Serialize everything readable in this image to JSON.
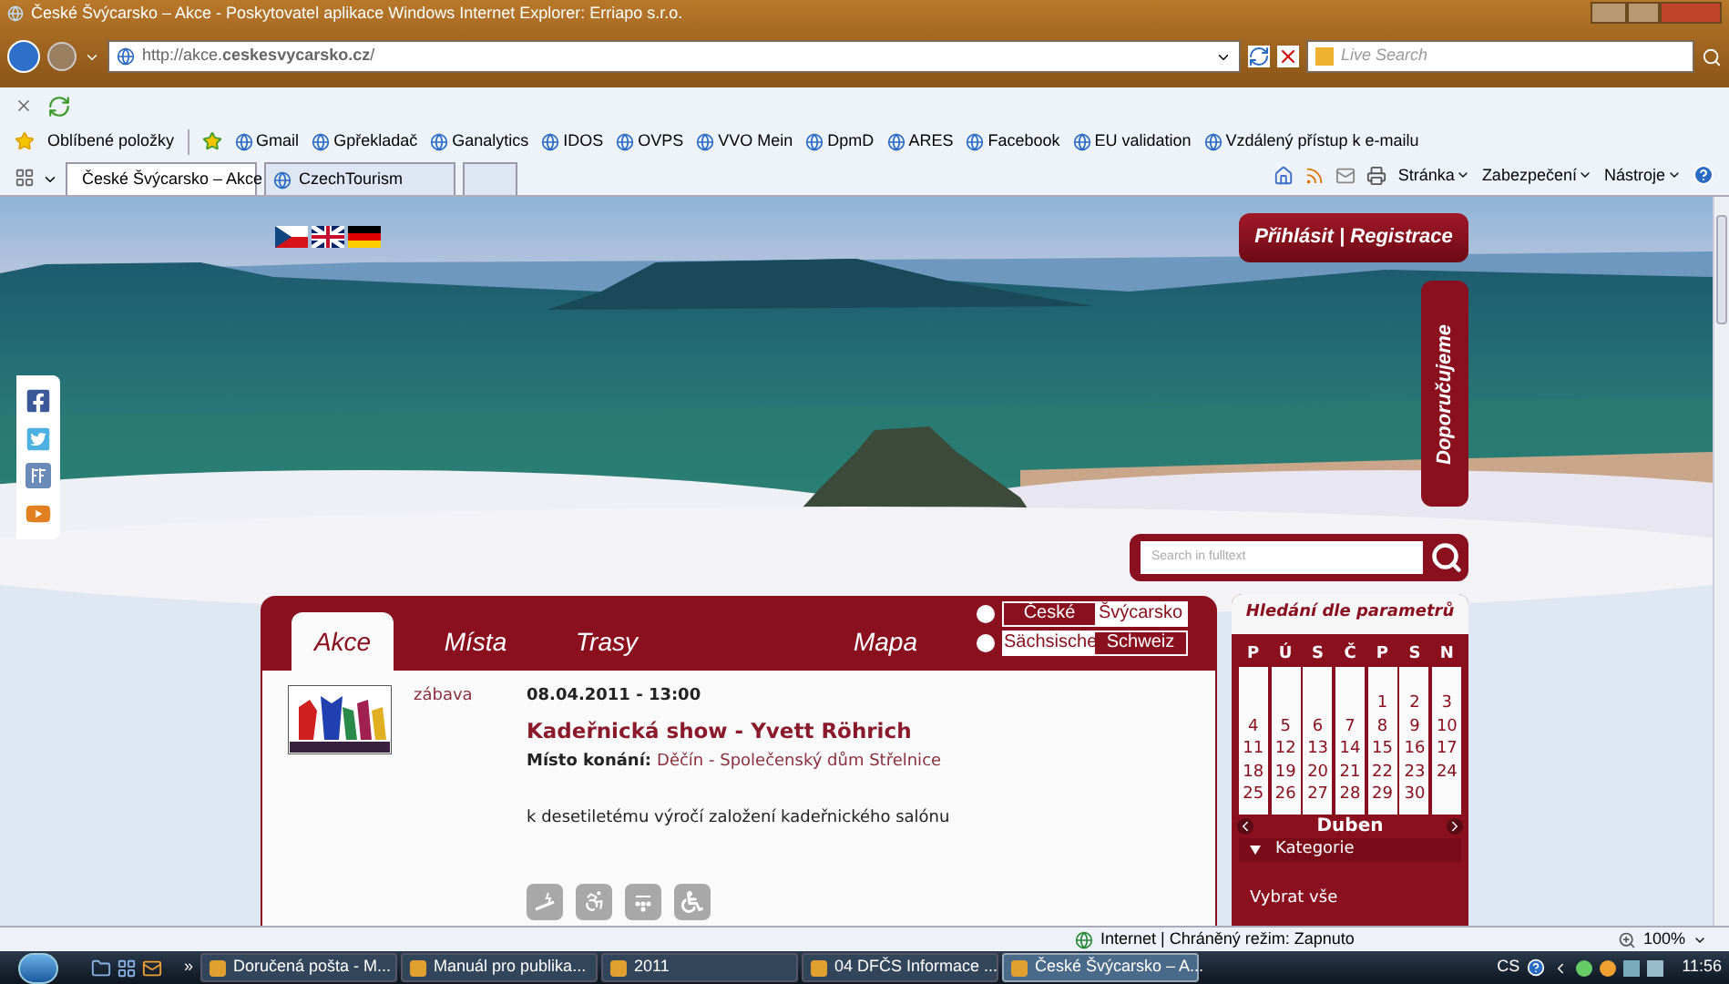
{
  "window": {
    "title": "České Švýcarsko – Akce - Poskytovatel aplikace Windows Internet Explorer: Erriapo s.r.o."
  },
  "address_bar": {
    "url": "http://akce.**ceskesvycarsko.cz**/"
  },
  "search": {
    "placeholder": "Live Search"
  },
  "favorites_bar": {
    "label": "Oblíbené položky",
    "links": [
      "Gmail",
      "Gpřekladač",
      "Ganalytics",
      "IDOS",
      "OVPS",
      "VVO Mein",
      "DpmD",
      "ARES",
      "Facebook",
      "EU validation",
      "Vzdálený přístup k e-mailu"
    ]
  },
  "tabs": [
    {
      "label": "České Švýcarsko – Akce",
      "selected": true
    },
    {
      "label": "CzechTourism",
      "selected": false
    }
  ],
  "command_bar": [
    "Stránka",
    "Zabezpečení",
    "Nástroje"
  ],
  "page": {
    "login": "Přihlásit | Registrace",
    "recommend_tab": "Doporučujeme",
    "fulltext_search": {
      "placeholder": "Search in fulltext"
    },
    "panel": {
      "tabs": [
        {
          "label": "Akce",
          "selected": true
        },
        {
          "label": "Místa",
          "selected": false
        },
        {
          "label": "Trasy",
          "selected": false
        },
        {
          "label": "Mapa",
          "selected": false
        }
      ],
      "language_switch": [
        {
          "selected": false,
          "words": [
            {
              "text": "České",
              "highlighted": false
            },
            {
              "text": "Švýcarsko",
              "highlighted": true
            }
          ]
        },
        {
          "selected": false,
          "words": [
            {
              "text": "Sächsische",
              "highlighted": true
            },
            {
              "text": "Schweiz",
              "highlighted": false
            }
          ]
        }
      ],
      "event": {
        "category": "zábava",
        "datetime": "08.04.2011 - 13:00",
        "title": "Kadeřnická show - Yvett Röhrich",
        "venue_label": "Místo konání:",
        "venue": "Děčín - Společenský dům Střelnice",
        "description": "k desetiletému výročí založení kadeřnického salónu"
      }
    },
    "calendar": {
      "title": "Hledání dle parametrů",
      "columns": [
        {
          "label": "P",
          "first_week": false,
          "days": [
            "4",
            "11",
            "18",
            "25"
          ]
        },
        {
          "label": "Ú",
          "first_week": false,
          "days": [
            "5",
            "12",
            "19",
            "26"
          ]
        },
        {
          "label": "S",
          "first_week": false,
          "days": [
            "6",
            "13",
            "20",
            "27"
          ]
        },
        {
          "label": "Č",
          "first_week": false,
          "days": [
            "7",
            "14",
            "21",
            "28"
          ]
        },
        {
          "label": "P",
          "first_week": true,
          "days": [
            "1",
            "8",
            "15",
            "22",
            "29"
          ]
        },
        {
          "label": "S",
          "first_week": true,
          "days": [
            "2",
            "9",
            "16",
            "23",
            "30"
          ]
        },
        {
          "label": "N",
          "first_week": true,
          "days": [
            "3",
            "10",
            "17",
            "24"
          ]
        }
      ],
      "month": "Duben",
      "category_toggle": {
        "label": "Kategorie",
        "expanded": true
      },
      "select_all": "Vybrat vše"
    }
  },
  "status_bar": {
    "zone": "Internet | Chráněný režim: Zapnuto",
    "zoom": "100%"
  },
  "taskbar": {
    "more": "»",
    "tasks": [
      {
        "label": "Doručená pošta - M...",
        "selected": false
      },
      {
        "label": "Manuál pro publika...",
        "selected": false
      },
      {
        "label": "2011",
        "selected": false
      },
      {
        "label": "04 DFČS Informace ...",
        "selected": false
      },
      {
        "label": "České Švýcarsko – A...",
        "selected": true
      }
    ],
    "language": "CS",
    "clock": "11:56"
  }
}
